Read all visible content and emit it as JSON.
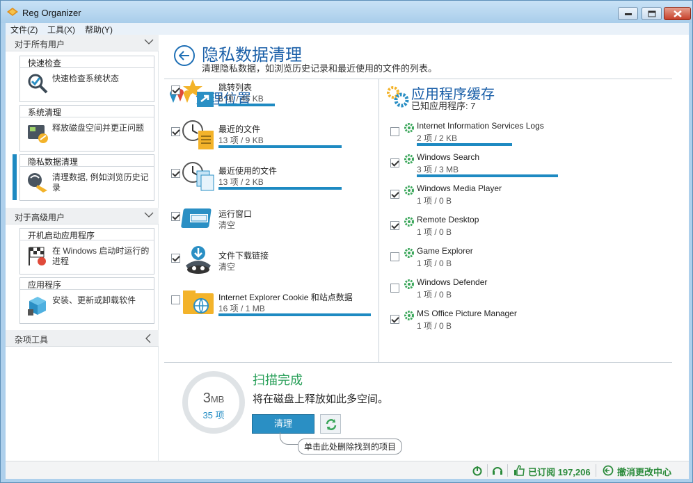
{
  "app": {
    "title": "Reg Organizer"
  },
  "menu": [
    "文件(Z)",
    "工具(X)",
    "帮助(Y)"
  ],
  "sidebar": {
    "groups": [
      {
        "label": "对于所有用户"
      },
      {
        "label": "对于高级用户"
      },
      {
        "label": "杂项工具"
      }
    ],
    "cards": [
      {
        "title": "快速检查",
        "text": "快速检查系统状态",
        "icon": "magnifier-check-icon"
      },
      {
        "title": "系统清理",
        "text": "释放磁盘空间并更正问题",
        "icon": "disk-cleanup-icon"
      },
      {
        "title": "隐私数据清理",
        "text": "清理数据, 例如浏览历史记录",
        "icon": "privacy-broom-icon"
      },
      {
        "title": "开机启动应用程序",
        "text": "在 Windows 启动时运行的进程",
        "icon": "startup-flag-icon"
      },
      {
        "title": "应用程序",
        "text": "安装、更新或卸载软件",
        "icon": "app-box-icon"
      }
    ]
  },
  "page": {
    "title": "隐私数据清理",
    "description": "清理隐私数据，如浏览历史记录和最近使用的文件的列表。"
  },
  "locations": {
    "title": "清理位置",
    "items": [
      {
        "name": "跳转列表",
        "detail": "6 项 / 45 KB",
        "checked": true,
        "progress": 0.37,
        "icon": "star-jumplist-icon"
      },
      {
        "name": "最近的文件",
        "detail": "13 项 / 9 KB",
        "checked": true,
        "progress": 0.81,
        "icon": "clock-document-icon"
      },
      {
        "name": "最近使用的文件",
        "detail": "13 项 / 2 KB",
        "checked": true,
        "progress": 0.81,
        "icon": "clock-files-icon"
      },
      {
        "name": "运行窗口",
        "detail": "清空",
        "checked": true,
        "progress": 0,
        "icon": "run-window-icon"
      },
      {
        "name": "文件下载链接",
        "detail": "清空",
        "checked": true,
        "progress": 0,
        "icon": "download-spy-icon"
      },
      {
        "name": "Internet Explorer Cookie 和站点数据",
        "detail": "16 项 / 1 MB",
        "checked": false,
        "progress": 1.0,
        "icon": "ie-folder-icon"
      }
    ]
  },
  "cache": {
    "title": "应用程序缓存",
    "subtitle": "已知应用程序: 7",
    "items": [
      {
        "name": "Internet Information Services Logs",
        "detail": "2 项 / 2 KB",
        "checked": false,
        "progress": 0.58
      },
      {
        "name": "Windows Search",
        "detail": "3 项 / 3 MB",
        "checked": true,
        "progress": 0.86
      },
      {
        "name": "Windows Media Player",
        "detail": "1 项 / 0 B",
        "checked": true,
        "progress": 0
      },
      {
        "name": "Remote Desktop",
        "detail": "1 项 / 0 B",
        "checked": true,
        "progress": 0
      },
      {
        "name": "Game Explorer",
        "detail": "1 项 / 0 B",
        "checked": false,
        "progress": 0
      },
      {
        "name": "Windows Defender",
        "detail": "1 项 / 0 B",
        "checked": false,
        "progress": 0
      },
      {
        "name": "MS Office Picture Manager",
        "detail": "1 项 / 0 B",
        "checked": true,
        "progress": 0
      }
    ]
  },
  "scan": {
    "size_value": "3",
    "size_unit": "MB",
    "items_count": "35 项",
    "title": "扫描完成",
    "subtitle": "将在磁盘上释放如此多空间。",
    "clean_label": "清理",
    "tooltip": "单击此处删除找到的项目"
  },
  "status": {
    "subscribed": "已订阅 197,206",
    "undo": "撤消更改中心"
  },
  "colors": {
    "accent": "#1e8ac2",
    "title_blue": "#1a5fa8",
    "success": "#2aa05a"
  }
}
